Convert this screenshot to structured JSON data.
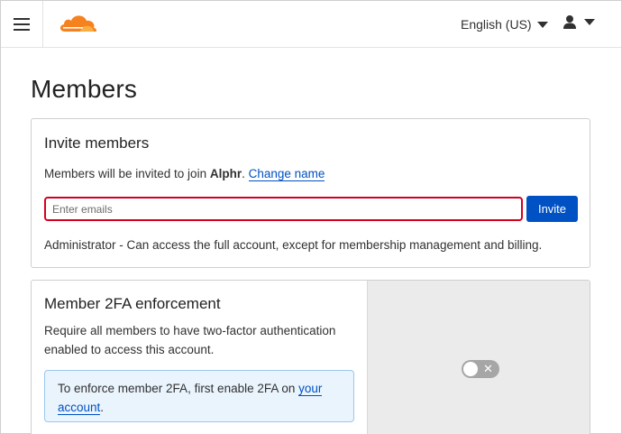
{
  "header": {
    "menu_icon": "hamburger-icon",
    "logo_icon": "cloud-logo",
    "language": "English (US)",
    "user_icon": "user-icon"
  },
  "page": {
    "title": "Members"
  },
  "invite": {
    "title": "Invite members",
    "text_prefix": "Members will be invited to join ",
    "account_name": "Alphr",
    "text_suffix": ".",
    "change_name_link": "Change name",
    "email_placeholder": "Enter emails",
    "invite_button": "Invite",
    "role_description": "Administrator - Can access the full account, except for membership management and billing."
  },
  "twofa": {
    "title": "Member 2FA enforcement",
    "description": "Require all members to have two-factor authentication enabled to access this account.",
    "notice_prefix": "To enforce member 2FA, first enable 2FA on ",
    "notice_link": "your account",
    "notice_suffix": ".",
    "toggle_enabled": false
  },
  "colors": {
    "brand_orange": "#f6821f",
    "link_blue": "#0051c3",
    "input_error": "#d4001f",
    "notice_bg": "#eaf4fd"
  }
}
